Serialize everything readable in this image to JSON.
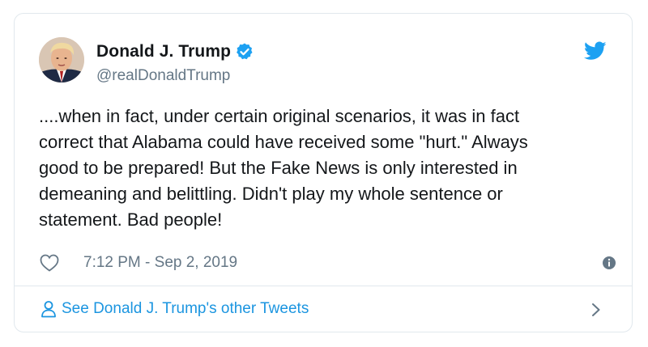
{
  "tweet": {
    "author_name": "Donald J. Trump",
    "author_handle": "@realDonaldTrump",
    "text": "....when in fact, under certain original scenarios, it was in fact\ncorrect that Alabama could have received some \"hurt.\" Always\ngood to be prepared! But the Fake News is only interested in\ndemeaning and belittling. Didn't play my whole sentence or\nstatement. Bad people!",
    "timestamp": "7:12 PM - Sep 2, 2019",
    "see_more_label": "See Donald J. Trump's other Tweets"
  },
  "colors": {
    "brand_blue": "#1da1f2",
    "link_blue": "#1b95e0",
    "secondary_text": "#657786",
    "border": "#e1e8ed"
  },
  "icons": [
    "avatar",
    "verified-badge-icon",
    "twitter-bird-icon",
    "heart-icon",
    "info-icon",
    "person-icon",
    "chevron-right-icon"
  ]
}
